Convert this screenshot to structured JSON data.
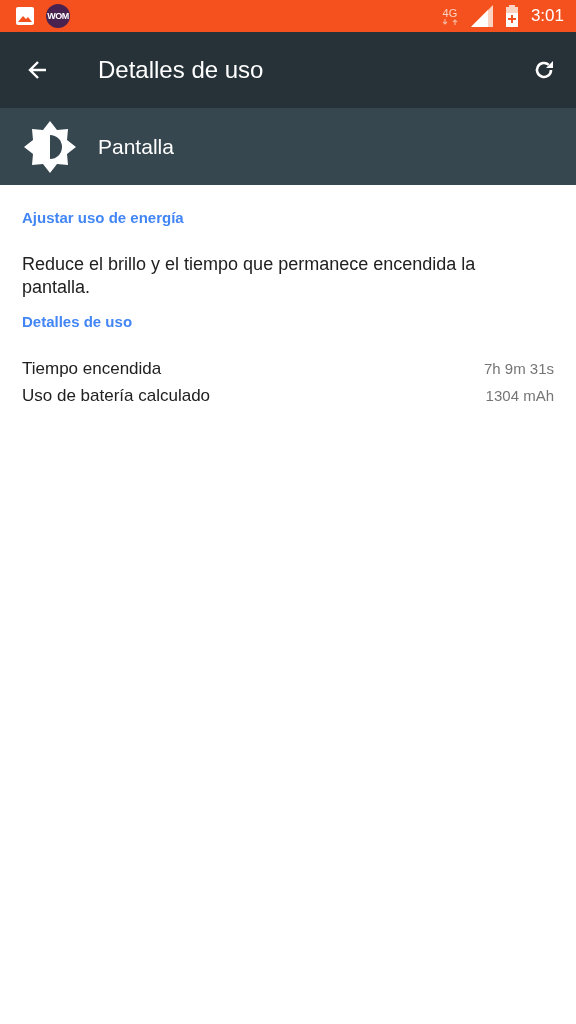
{
  "status_bar": {
    "app_badge": "WOM",
    "network": "4G",
    "time": "3:01"
  },
  "toolbar": {
    "title": "Detalles de uso"
  },
  "app_header": {
    "name": "Pantalla"
  },
  "sections": [
    {
      "title": "Ajustar uso de energía",
      "description": "Reduce el brillo y el tiempo que permanece encendida la pantalla."
    },
    {
      "title": "Detalles de uso",
      "rows": [
        {
          "label": "Tiempo encendida",
          "value": "7h 9m 31s"
        },
        {
          "label": "Uso de batería calculado",
          "value": "1304 mAh"
        }
      ]
    }
  ]
}
